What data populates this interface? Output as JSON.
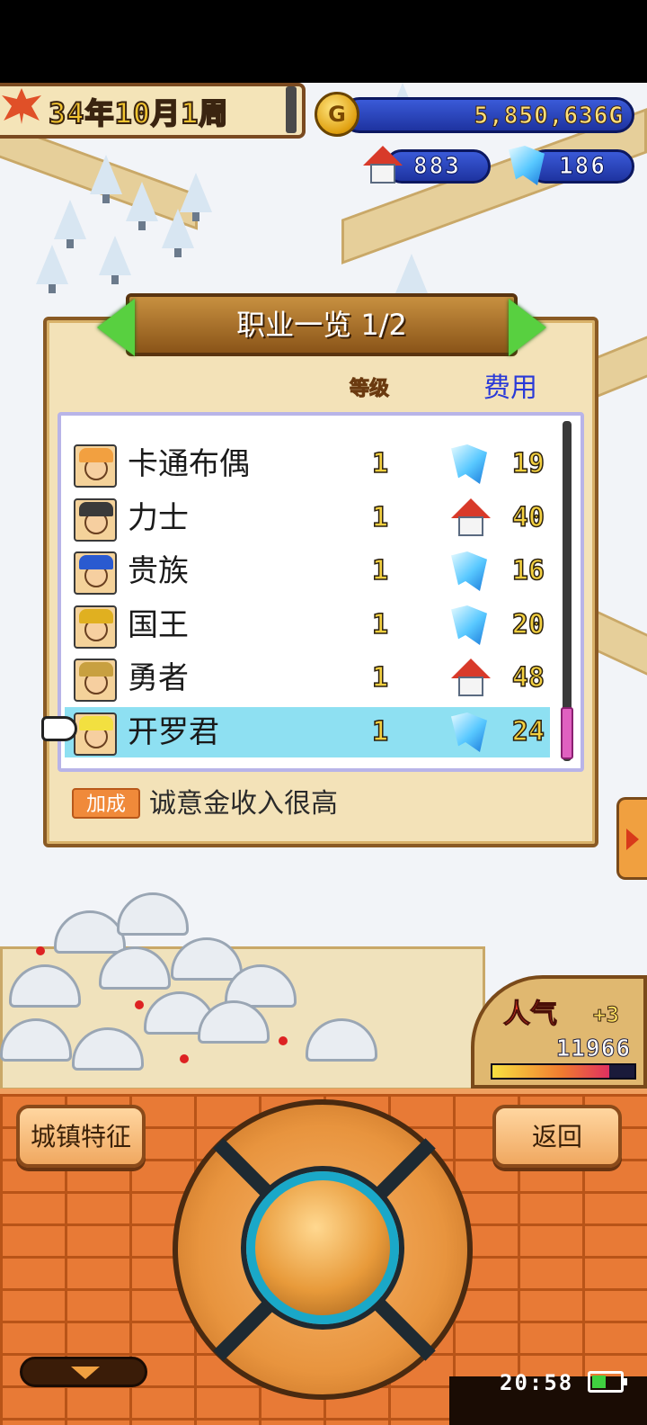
{
  "hud": {
    "date": "34年10月1周",
    "gold": "5,850,636G",
    "houses": "883",
    "crystals": "186"
  },
  "panel": {
    "title": "职业一览 1/2",
    "col_level": "等级",
    "col_cost": "费用",
    "rows": [
      {
        "name": "卡通布偶",
        "level": "1",
        "cost_icon": "crystal-icon",
        "cost": "19",
        "avatar_color": "#f2a040"
      },
      {
        "name": "力士",
        "level": "1",
        "cost_icon": "house-icon",
        "cost": "40",
        "avatar_color": "#3a3a3a"
      },
      {
        "name": "贵族",
        "level": "1",
        "cost_icon": "crystal-icon",
        "cost": "16",
        "avatar_color": "#2a5ad0"
      },
      {
        "name": "国王",
        "level": "1",
        "cost_icon": "crystal-icon",
        "cost": "20",
        "avatar_color": "#e0b020"
      },
      {
        "name": "勇者",
        "level": "1",
        "cost_icon": "house-icon",
        "cost": "48",
        "avatar_color": "#c8a040"
      },
      {
        "name": "开罗君",
        "level": "1",
        "cost_icon": "crystal-icon",
        "cost": "24",
        "avatar_color": "#f2e040"
      }
    ],
    "selected_index": 5,
    "bonus_tag": "加成",
    "bonus_text": "诚意金收入很高"
  },
  "popularity": {
    "label": "人气",
    "bonus": "+3",
    "value": "11966",
    "meter_level": 0.82
  },
  "controls": {
    "town_features": "城镇特征",
    "back": "返回"
  },
  "system": {
    "time": "20:58",
    "battery_level": 0.5
  },
  "colors": {
    "accent_gold": "#f3d040",
    "cost_header": "#2a3ad8",
    "selected_row": "#8ee0f2"
  }
}
